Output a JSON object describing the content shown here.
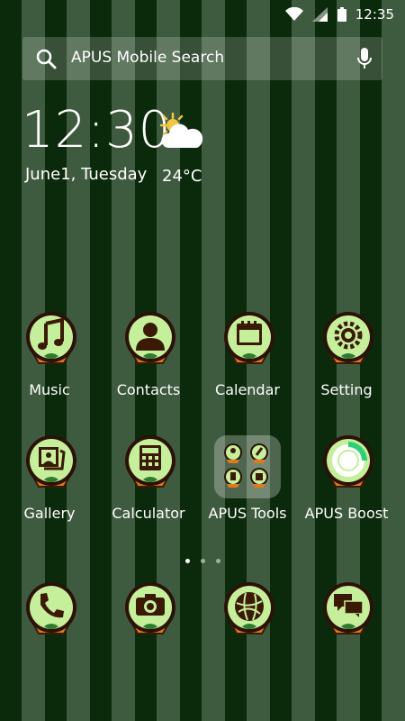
{
  "status": {
    "time": "12:35"
  },
  "search": {
    "placeholder": "APUS Mobile Search"
  },
  "widget": {
    "clock": "12:30",
    "date": "June1, Tuesday",
    "temperature": "24°C",
    "weather_icon": "sun-cloud-icon"
  },
  "apps_row1": [
    {
      "label": "Music",
      "icon": "music-note-icon"
    },
    {
      "label": "Contacts",
      "icon": "contact-person-icon"
    },
    {
      "label": "Calendar",
      "icon": "calendar-icon"
    },
    {
      "label": "Setting",
      "icon": "gear-icon"
    }
  ],
  "apps_row2": [
    {
      "label": "Gallery",
      "icon": "gallery-icon"
    },
    {
      "label": "Calculator",
      "icon": "calculator-icon"
    },
    {
      "label": "APUS Tools",
      "icon": "folder-icon"
    },
    {
      "label": "APUS Boost",
      "icon": "boost-ring-icon"
    }
  ],
  "dock": [
    {
      "icon": "phone-icon"
    },
    {
      "icon": "camera-icon"
    },
    {
      "icon": "browser-globe-icon"
    },
    {
      "icon": "messages-icon"
    }
  ],
  "colors": {
    "dark_stripe": "#0b2a0b",
    "light_stripe": "#3f5b3f",
    "icon_green": "#c6ef9c",
    "icon_brown": "#3a1a05",
    "pot_orange": "#e07a1c"
  }
}
